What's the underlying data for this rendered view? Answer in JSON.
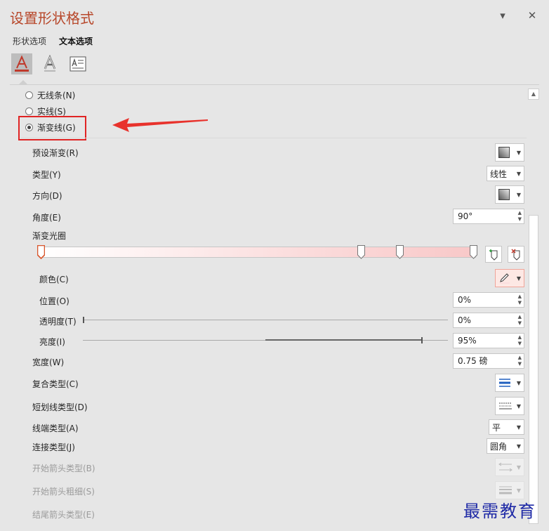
{
  "header": {
    "title": "设置形状格式",
    "menu_glyph": "▾",
    "close_glyph": "✕"
  },
  "tabs": [
    {
      "label": "形状选项"
    },
    {
      "label": "文本选项"
    }
  ],
  "icons": [
    "text-fill-icon",
    "text-effect-icon",
    "text-box-icon"
  ],
  "line_options": {
    "none": "无线条(N)",
    "solid": "实线(S)",
    "gradient": "渐变线(G)"
  },
  "fields": {
    "preset": "预设渐变(R)",
    "type": "类型(Y)",
    "type_value": "线性",
    "direction": "方向(D)",
    "angle": "角度(E)",
    "angle_value": "90°",
    "stops": "渐变光圈",
    "color": "颜色(C)",
    "position": "位置(O)",
    "position_value": "0%",
    "transparency": "透明度(T)",
    "transparency_value": "0%",
    "brightness": "亮度(I)",
    "brightness_value": "95%",
    "width": "宽度(W)",
    "width_value": "0.75 磅",
    "compound": "复合类型(C)",
    "dash": "短划线类型(D)",
    "cap": "线端类型(A)",
    "cap_value": "平",
    "join": "连接类型(J)",
    "join_value": "圆角",
    "begin_arrow_type": "开始箭头类型(B)",
    "begin_arrow_size": "开始箭头粗细(S)",
    "end_arrow_type": "结尾箭头类型(E)"
  },
  "gradient_stops": [
    0,
    0.74,
    0.83,
    1
  ],
  "transparency_level": 0,
  "brightness_level": 0.95,
  "colors": {
    "accent": "#b7472a",
    "highlight": "#e02424",
    "stop_selected": "#d8562c"
  },
  "watermark": "最需教育"
}
